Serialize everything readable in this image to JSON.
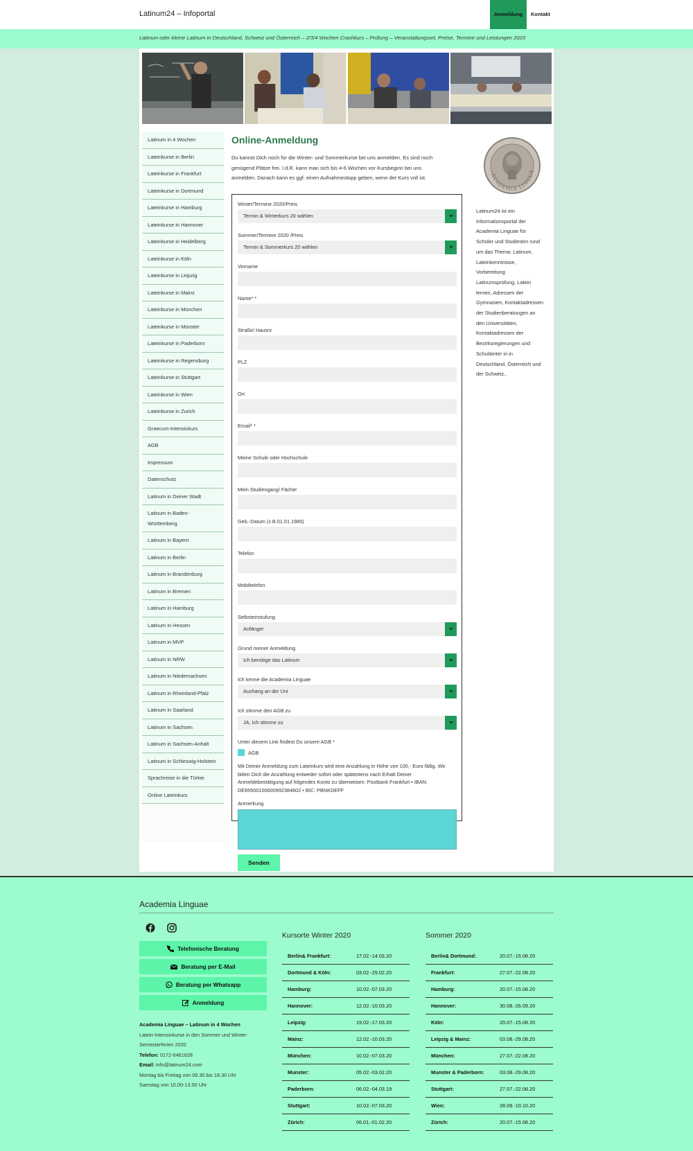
{
  "header": {
    "site_title": "Latinum24 – Infoportal",
    "nav": [
      "Anmeldung",
      "Kontakt"
    ],
    "tagline": "Latinum oder kleine Latinum in Deutschland, Schweiz und Österreich – 2/3/4 Wochen Crashkurs – Prüfung – Veranstaltungsort, Preise, Termine und Leistungen 2020"
  },
  "sidebar": {
    "items": [
      "Latinum in 4 Wochen",
      "Lateinkurse in Berlin",
      "Lateinkurse in Frankfurt",
      "Lateinkurse in Dortmund",
      "Lateinkurse in Hamburg",
      "Lateinkurse in Hannover",
      "Lateinkurse in Heidelberg",
      "Lateinkurse in Köln",
      "Lateinkurse in Leipzig",
      "Lateinkurse in Mainz",
      "Lateinkurse in München",
      "Lateinkurse in Münster",
      "Lateinkurse in Paderborn",
      "Lateinkurse in Regensburg",
      "Lateinkurse in Stuttgart",
      "Lateinkurse in Wien",
      "Lateinkurse in Zurich",
      "Graecum-Intensivkurs",
      "AGB",
      "Impressum",
      "Datenschutz",
      "Latinum in Deiner Stadt",
      "Latinum in Baden-Württemberg",
      "Latinum in Bayern",
      "Latinum in Berlin",
      "Latinum in Brandenburg",
      "Latinum in Bremen",
      "Latinum in Hamburg",
      "Latinum in Hessen",
      "Latinum in MVP",
      "Latinum in NRW",
      "Latinum in Niedersachsen",
      "Latinum in Rheinland-Pfalz",
      "Latinum in Saarland",
      "Latinum in Sachsen",
      "Latinum in Sachsen-Anhalt",
      "Latinum in Schleswig-Holstein",
      "Sprachreise in die Türkei",
      "Online Lateinkurs"
    ]
  },
  "main": {
    "title": "Online-Anmeldung",
    "intro": "Du kannst Dich noch für die Winter- und Sommerkurse bei uns anmelden. Es sind noch genügend Plätze frei. I.d.R. kann man sich bis 4-6 Wochen vor Kursbeginn bei uns anmelden. Danach kann es ggf. einen Aufnahmestopp geben, wenn der Kurs voll ist."
  },
  "form": {
    "winter_label": "Winter/Termine 2020/Preis",
    "winter_value": "Termin & Winterkurs 20 wählen",
    "summer_label": "Sommer/Termine 2020 /Preis",
    "summer_value": "Termin & Sommerkurs 20 wählen",
    "vorname_label": "Vorname",
    "name_label": "Name* *",
    "strasse_label": "Straße/ Hausnr",
    "plz_label": "PLZ",
    "ort_label": "Ort",
    "email_label": "Email* *",
    "schule_label": "Meine Schule oder Hochschule",
    "studiengang_label": "Mein Studiengang/ Fächer",
    "geb_label": "Geb.-Datum (z.B.01.01.1985)",
    "telefon_label": "Telefon",
    "mobil_label": "Mobiltelefon",
    "selbst_label": "Selbsteinstufung",
    "selbst_value": "Anfänger",
    "grund_label": "Grund meiner Anmeldung",
    "grund_value": "Ich benötige das Latinum",
    "kenne_label": "Ich kenne die Academia Linguae",
    "kenne_value": "Aushang an der Uni",
    "agb_label": "Ich stimme den AGB zu",
    "agb_value": "JA, Ich stimme zu",
    "link_label": "Unter diesem Link findest Du unsere AGB *",
    "checkbox_label": "AGB",
    "notice": "Mit Deiner Anmeldung zum Lateinkurs wird eine Anzahlung in Höhe von 100,- Euro fällig. Wir bitten Dich die Anzahlung entweder sofort oder spätestens nach Erhalt Deiner Anmeldebestätigung auf folgendes Konto zu überweisen: Postbank Frankfurt • IBAN: DE85500100600992384602 • BIC: PBNKDEFF",
    "anmerkung_label": "Anmerkung",
    "submit": "Senden"
  },
  "right": {
    "seal_text": "ACADEMIA LINGUAE",
    "text": "Latinum24 ist ein Informationsportal der Academia Linguae für Schüler und Studenten rund um das Thema: Latinum, Lateinkenntnisse, Vorbereitung Latinumsprüfung, Latein lernen, Adressen der Gymnasien, Kontaktadressen der Studienberatungen an den Universitäten, Kontaktadressen der Bezirksregierungen und Schulämter in in Deutschland, Österreich und der Schweiz.."
  },
  "footer": {
    "title": "Academia Linguae",
    "social_icons": [
      "facebook-icon",
      "instagram-icon"
    ],
    "buttons": [
      {
        "label": "Telefonische Beratung",
        "icon": "phone-icon"
      },
      {
        "label": "Beratung per E-Mail",
        "icon": "envelope-icon"
      },
      {
        "label": "Beratung per Whatsapp",
        "icon": "whatsapp-icon"
      },
      {
        "label": "Anmeldung",
        "icon": "edit-icon"
      }
    ],
    "contact": {
      "name": "Academia Linguae – Latinum in 4 Wochen",
      "desc": "Latein-Intensivkurse in den Sommer und Winter-Semesterferien 2020",
      "phone_label": "Telefon:",
      "phone": " 0172-6461628",
      "email_label": "Email:",
      "email": " info@latinum24.com",
      "hours1": "Montag bis Freitag von 09.30 bis 18.30 Uhr",
      "hours2": "Samstag von 10.00-13.00 Uhr"
    },
    "winter": {
      "title": "Kursorte Winter 2020",
      "rows": [
        [
          "Berlin& Frankfurt:",
          "17.02.-14.03.20"
        ],
        [
          "Dortmund & Köln:",
          "03.02.-29.02.20"
        ],
        [
          "Hamburg:",
          "10.02.-07.03.20"
        ],
        [
          "Hannover:",
          "12.02.-10.03.20"
        ],
        [
          "Leipzig:",
          "19.02.-17.03.20"
        ],
        [
          "Mainz:",
          "12.02.-10.03.20"
        ],
        [
          "München:",
          "10.02.-07.03.20"
        ],
        [
          "Munster:",
          "05.02.-03.02.20"
        ],
        [
          "Paderborn:",
          "06.02.-04.03.19"
        ],
        [
          "Stuttgart:",
          "10.02.-07.03.20"
        ],
        [
          "Zürich:",
          "06.01.-01.02.20"
        ]
      ]
    },
    "summer": {
      "title": "Sommer 2020",
      "rows": [
        [
          "Berlin& Dortmund:",
          "20.07.-15.08.20"
        ],
        [
          "Frankfurt:",
          "27.07.-22.08.20"
        ],
        [
          "Hamburg:",
          "20.07.-15.08.20"
        ],
        [
          "Hannover:",
          "30.08.-26.09.20"
        ],
        [
          "Köln:",
          "20.07.-15.08.20"
        ],
        [
          "Leipzig & Mainz:",
          "03.08.-29.08.20"
        ],
        [
          "München:",
          "27.07.-22.08.20"
        ],
        [
          "Munster & Paderborn:",
          "03.08.-29.08.20"
        ],
        [
          "Stuttgart:",
          "27.07.-22.08.20"
        ],
        [
          "Wien:",
          "28.09.-10.10.20"
        ],
        [
          "Zürich:",
          "20.07.-15.08.20"
        ]
      ]
    }
  },
  "colors": {
    "accent": "#209a5b",
    "mint": "#9dfcce",
    "button": "#5cf5a9",
    "background": "#d2ecdf"
  }
}
